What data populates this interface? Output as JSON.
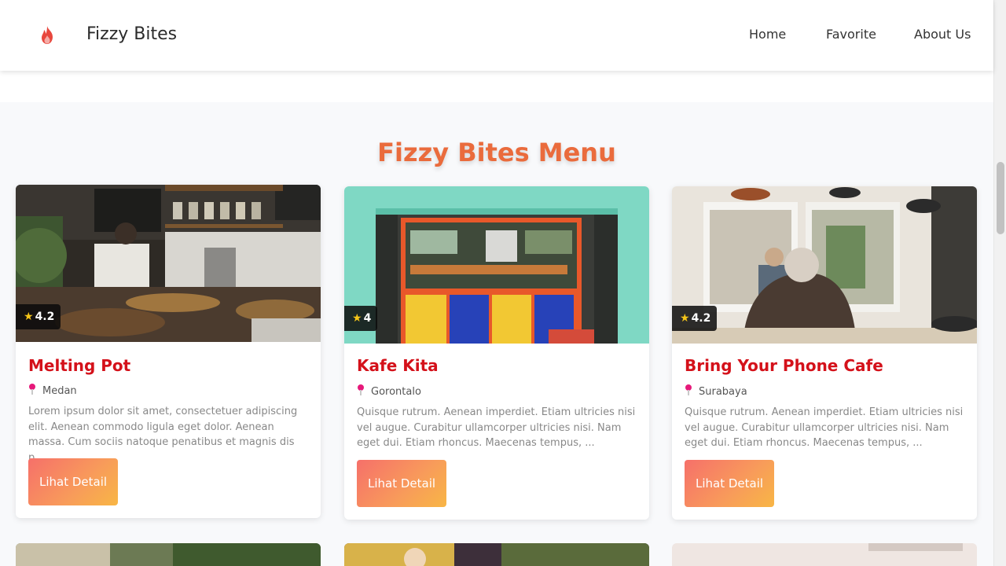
{
  "header": {
    "brand": "Fizzy Bites",
    "logo_icon": "fire-icon",
    "nav": [
      {
        "label": "Home"
      },
      {
        "label": "Favorite"
      },
      {
        "label": "About Us"
      }
    ]
  },
  "menu": {
    "title": "Fizzy Bites Menu",
    "button_label": "Lihat Detail",
    "restaurants": [
      {
        "name": "Melting Pot",
        "rating": "4.2",
        "city": "Medan",
        "description": "Lorem ipsum dolor sit amet, consectetuer adipiscing elit. Aenean commodo ligula eget dolor. Aenean massa. Cum sociis natoque penatibus et magnis dis p..."
      },
      {
        "name": "Kafe Kita",
        "rating": "4",
        "city": "Gorontalo",
        "description": "Quisque rutrum. Aenean imperdiet. Etiam ultricies nisi vel augue. Curabitur ullamcorper ultricies nisi. Nam eget dui. Etiam rhoncus. Maecenas tempus, ..."
      },
      {
        "name": "Bring Your Phone Cafe",
        "rating": "4.2",
        "city": "Surabaya",
        "description": "Quisque rutrum. Aenean imperdiet. Etiam ultricies nisi vel augue. Curabitur ullamcorper ultricies nisi. Nam eget dui. Etiam rhoncus. Maecenas tempus, ..."
      }
    ]
  },
  "colors": {
    "accent": "#ea6b3c",
    "title_red": "#d4111a",
    "pin": "#e6197a",
    "star": "#f5c518"
  }
}
